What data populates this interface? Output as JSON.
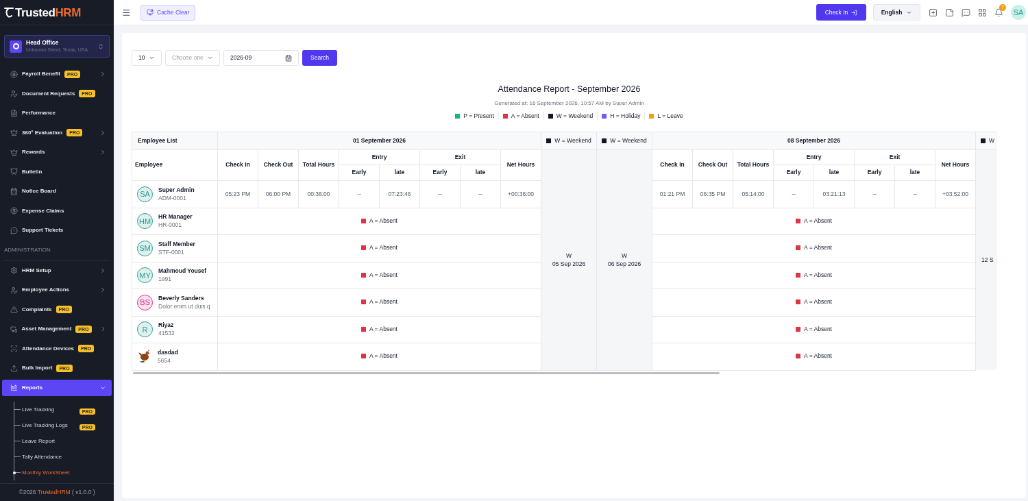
{
  "sidebar": {
    "logo": {
      "first": "Trusted",
      "second": "HRM"
    },
    "branch": {
      "name": "Head Office",
      "address": "Unknown Street, Texas, USA"
    },
    "items": [
      {
        "kind": "menu",
        "label": "Payroll Benefit",
        "badge": "PRO",
        "expanded": false,
        "selected": false
      },
      {
        "kind": "item",
        "label": "Document Requests",
        "badge": "PRO",
        "selected": false
      },
      {
        "kind": "item",
        "label": "Performance",
        "selected": false
      },
      {
        "kind": "menu",
        "label": "360° Evaluation",
        "badge": "PRO",
        "expanded": false,
        "selected": false
      },
      {
        "kind": "menu",
        "label": "Rewards",
        "expanded": false,
        "selected": false
      },
      {
        "kind": "item",
        "label": "Bulletin",
        "selected": false
      },
      {
        "kind": "item",
        "label": "Notice Board",
        "selected": false
      },
      {
        "kind": "item",
        "label": "Expense Claims",
        "selected": false
      },
      {
        "kind": "item",
        "label": "Support Tickets",
        "selected": false
      },
      {
        "kind": "section",
        "label": "ADMINISTRATION"
      },
      {
        "kind": "menu",
        "label": "HRM Setup",
        "expanded": false,
        "selected": false
      },
      {
        "kind": "menu",
        "label": "Employee Actions",
        "expanded": false,
        "selected": false
      },
      {
        "kind": "item",
        "label": "Complaints",
        "badge": "PRO",
        "selected": false
      },
      {
        "kind": "menu",
        "label": "Asset Management",
        "badge": "PRO",
        "expanded": false,
        "selected": false
      },
      {
        "kind": "item",
        "label": "Attendance Devices",
        "badge": "PRO",
        "selected": false
      },
      {
        "kind": "item",
        "label": "Bulk Import",
        "badge": "PRO",
        "selected": false
      },
      {
        "kind": "menu",
        "label": "Reports",
        "expanded": true,
        "selected": true,
        "children": [
          {
            "label": "Live Tracking",
            "badge": "PRO",
            "selected": false
          },
          {
            "label": "Live Tracking Logs",
            "badge": "PRO",
            "selected": false
          },
          {
            "label": "Leave Report",
            "selected": false
          },
          {
            "label": "Tally Attendance",
            "selected": false
          },
          {
            "label": "Monthly WorkSheet",
            "selected": true
          }
        ]
      }
    ],
    "footer": {
      "year": "©2026",
      "brand": "TrustedHRM",
      "version": "( v1.0.0 )"
    }
  },
  "topbar": {
    "cache_button": "Cache Clear",
    "check_in_button": "Check In",
    "language": "English",
    "notification_count": "7",
    "avatar": "SA"
  },
  "filters": {
    "per_page": "10",
    "select_placeholder": "Choose one",
    "month": "2026-09",
    "search_button": "Search"
  },
  "report": {
    "title": "Attendance Report - September 2026",
    "generated": "Generated at: 16 September 2026, 10:57 AM by Super Admin",
    "legend": [
      {
        "label": "P = Present",
        "color": "#10b981"
      },
      {
        "label": "A = Absent",
        "color": "#dc3545"
      },
      {
        "label": "W = Weekend",
        "color": "#111827"
      },
      {
        "label": "H = Holiday",
        "color": "#6c5dfc"
      },
      {
        "label": "L = Leave",
        "color": "#f59e0b"
      }
    ]
  },
  "table": {
    "employee_list_header": "Employee List",
    "employee_header": "Employee",
    "employees": [
      {
        "name": "Super Admin",
        "code": "ADM-0001",
        "avatar": {
          "kind": "initials",
          "initials": "SA",
          "color": "#2a9d8f"
        }
      },
      {
        "name": "HR Manager",
        "code": "HR-0001",
        "avatar": {
          "kind": "initials",
          "initials": "HM",
          "color": "#2a9d8f"
        }
      },
      {
        "name": "Staff Member",
        "code": "STF-0001",
        "avatar": {
          "kind": "initials",
          "initials": "SM",
          "color": "#2a9d8f"
        }
      },
      {
        "name": "Mahmoud Yousef",
        "code": "1991",
        "avatar": {
          "kind": "initials",
          "initials": "MY",
          "color": "#2a9d8f"
        }
      },
      {
        "name": "Beverly Sanders",
        "code": "Dolor enim ut duis q",
        "avatar": {
          "kind": "initials",
          "initials": "BS",
          "color": "#d63384"
        }
      },
      {
        "name": "Riyaz",
        "code": "41532",
        "avatar": {
          "kind": "initials",
          "initials": "R",
          "color": "#2a9d8f"
        }
      },
      {
        "name": "dasdad",
        "code": "5654"
      }
    ],
    "days": [
      {
        "kind": "workday",
        "title": "01 September 2026",
        "headers": {
          "check_in": "Check In",
          "check_out": "Check Out",
          "total_hours": "Total Hours",
          "entry": "Entry",
          "entry_early": "Early",
          "entry_late": "late",
          "exit": "Exit",
          "exit_early": "Early",
          "exit_late": "late",
          "net_hours": "Net Hours"
        },
        "records": [
          {
            "kind": "present",
            "check_in": "05:23 PM",
            "check_out": "06:00 PM",
            "total_hours": "00:36:00",
            "entry_early": "--",
            "entry_late": "07:23:46",
            "exit_early": "--",
            "exit_late": "--",
            "net_hours": "+00:36:00"
          },
          {
            "kind": "absent",
            "label": "A = Absent",
            "color": "#dc3545"
          },
          {
            "kind": "absent",
            "label": "A = Absent",
            "color": "#dc3545"
          },
          {
            "kind": "absent",
            "label": "A = Absent",
            "color": "#dc3545"
          },
          {
            "kind": "absent",
            "label": "A = Absent",
            "color": "#dc3545"
          },
          {
            "kind": "absent",
            "label": "A = Absent",
            "color": "#dc3545"
          },
          {
            "kind": "absent",
            "label": "A = Absent",
            "color": "#dc3545"
          }
        ]
      },
      {
        "kind": "weekend",
        "header": "W = Weekend",
        "color": "#111827",
        "mark": "W",
        "date": "05 Sep 2026"
      },
      {
        "kind": "weekend",
        "header": "W = Weekend",
        "color": "#111827",
        "mark": "W",
        "date": "06 Sep 2026"
      },
      {
        "kind": "workday",
        "title": "08 September 2026",
        "headers": {
          "check_in": "Check In",
          "check_out": "Check Out",
          "total_hours": "Total Hours",
          "entry": "Entry",
          "entry_early": "Early",
          "entry_late": "late",
          "exit": "Exit",
          "exit_early": "Early",
          "exit_late": "late",
          "net_hours": "Net Hours"
        },
        "records": [
          {
            "kind": "present",
            "check_in": "01:21 PM",
            "check_out": "06:35 PM",
            "total_hours": "05:14:00",
            "entry_early": "--",
            "entry_late": "03:21:13",
            "exit_early": "--",
            "exit_late": "--",
            "net_hours": "+03:52:00"
          },
          {
            "kind": "absent",
            "label": "A = Absent",
            "color": "#dc3545"
          },
          {
            "kind": "absent",
            "label": "A = Absent",
            "color": "#dc3545"
          },
          {
            "kind": "absent",
            "label": "A = Absent",
            "color": "#dc3545"
          },
          {
            "kind": "absent",
            "label": "A = Absent",
            "color": "#dc3545"
          },
          {
            "kind": "absent",
            "label": "A = Absent",
            "color": "#dc3545"
          },
          {
            "kind": "absent",
            "label": "A = Absent",
            "color": "#dc3545"
          }
        ]
      },
      {
        "kind": "partial",
        "header": "W",
        "color": "#111827",
        "date": "12 S"
      }
    ]
  }
}
